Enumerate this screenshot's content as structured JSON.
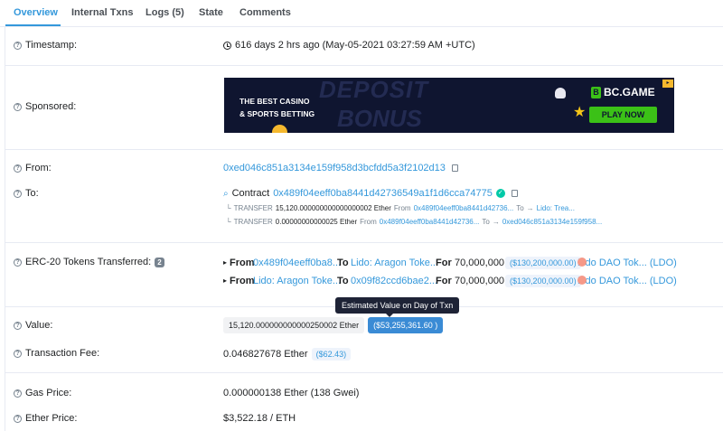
{
  "tabs": [
    "Overview",
    "Internal Txns",
    "Logs (5)",
    "State",
    "Comments"
  ],
  "timestamp": {
    "label": "Timestamp:",
    "value": "616 days 2 hrs ago (May-05-2021 03:27:59 AM +UTC)"
  },
  "sponsored": {
    "label": "Sponsored:",
    "headline_1": "THE BEST CASINO",
    "headline_2": "& SPORTS BETTING",
    "ghost_1": "DEPOSIT",
    "ghost_2": "BONUS",
    "brand": "BC.GAME",
    "brand_mark": "B",
    "cta": "PLAY NOW"
  },
  "from": {
    "label": "From:",
    "address": "0xed046c851a3134e159f958d3bcfdd5a3f2102d13"
  },
  "to": {
    "label": "To:",
    "prefix": "Contract",
    "address": "0x489f04eeff0ba8441d42736549a1f1d6cca74775",
    "transfers": [
      {
        "type": "TRANSFER",
        "amount": "15,120.000000000000000002 Ether",
        "from_word": "From",
        "from": "0x489f04eeff0ba8441d42736...",
        "to_word": "To",
        "arrow": "→",
        "to": "Lido: Trea..."
      },
      {
        "type": "TRANSFER",
        "amount": "0.00000000000025 Ether",
        "from_word": "From",
        "from": "0x489f04eeff0ba8441d42736...",
        "to_word": "To",
        "arrow": "→",
        "to": "0xed046c851a3134e159f958..."
      }
    ]
  },
  "erc20": {
    "label": "ERC-20 Tokens Transferred:",
    "count": "2",
    "rows": [
      {
        "from_word": "From",
        "from": "0x489f04eeff0ba8...",
        "to_word": "To",
        "to": "Lido: Aragon Toke...",
        "for_word": "For",
        "amount": "70,000,000",
        "usd": "($130,200,000.00)",
        "token": "Lido DAO Tok... (LDO)"
      },
      {
        "from_word": "From",
        "from": "Lido: Aragon Toke...",
        "to_word": "To",
        "to": "0x09f82ccd6bae2...",
        "for_word": "For",
        "amount": "70,000,000",
        "usd": "($130,200,000.00)",
        "token": "Lido DAO Tok... (LDO)"
      }
    ]
  },
  "value": {
    "label": "Value:",
    "ether": "15,120.000000000000250002 Ether",
    "usd": "($53,255,361.60 )",
    "tooltip": "Estimated Value on Day of Txn"
  },
  "fee": {
    "label": "Transaction Fee:",
    "ether": "0.046827678 Ether",
    "usd": "($62.43)"
  },
  "gas": {
    "label": "Gas Price:",
    "value": "0.000000138 Ether (138 Gwei)"
  },
  "ether_price": {
    "label": "Ether Price:",
    "value": "$3,522.18 / ETH"
  },
  "colors": {
    "link": "#3498db",
    "text": "#1e2022",
    "muted": "#77838f",
    "banner_bg": "#0f1530",
    "cta": "#3bc117"
  }
}
